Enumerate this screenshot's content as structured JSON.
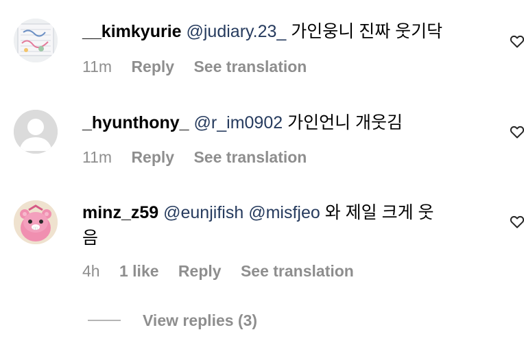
{
  "comments": [
    {
      "username": "__kimkyurie",
      "mention": "@judiary.23_",
      "text": "가인웅니 진짜 웃기닥",
      "time": "11m",
      "reply": "Reply",
      "translation": "See translation"
    },
    {
      "username": "_hyunthony_",
      "mention": "@r_im0902",
      "text": "가인언니 개웃김",
      "time": "11m",
      "reply": "Reply",
      "translation": "See translation"
    },
    {
      "username": "minz_z59",
      "mention1": "@eunjifish",
      "mention2": "@misfjeo",
      "text_line1": "와 제일 크게 웃",
      "text_line2": "음",
      "time": "4h",
      "likes": "1 like",
      "reply": "Reply",
      "translation": "See translation"
    }
  ],
  "view_replies": "View replies (3)"
}
